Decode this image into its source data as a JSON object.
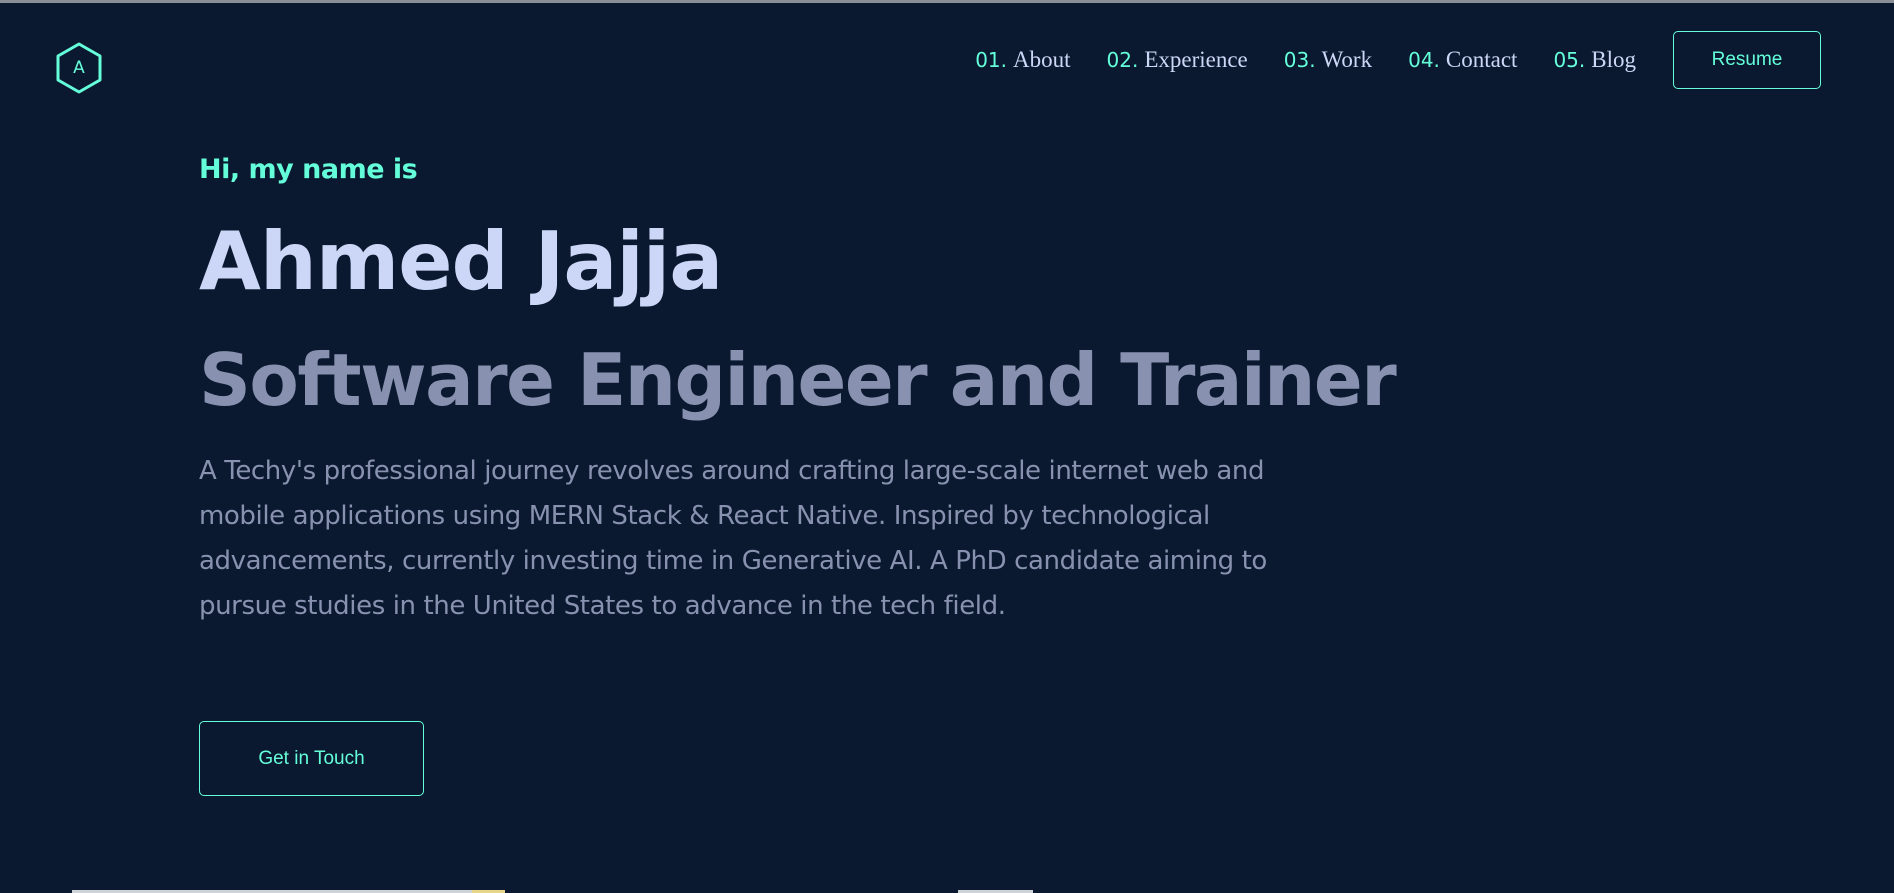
{
  "logo": {
    "letter": "A",
    "icon": "hexagon-logo-icon"
  },
  "nav": {
    "items": [
      {
        "num": "01.",
        "label": "About"
      },
      {
        "num": "02.",
        "label": "Experience"
      },
      {
        "num": "03.",
        "label": "Work"
      },
      {
        "num": "04.",
        "label": "Contact"
      },
      {
        "num": "05.",
        "label": "Blog"
      }
    ],
    "resume_label": "Resume"
  },
  "hero": {
    "greeting": "Hi, my name is",
    "name": "Ahmed Jajja",
    "title": "Software Engineer and Trainer",
    "description": "A Techy's professional journey revolves around crafting large-scale internet web and mobile applications using MERN Stack & React Native. Inspired by technological advancements, currently investing time in Generative AI. A PhD candidate aiming to pursue studies in the United States to advance in the tech field.",
    "cta_label": "Get in Touch"
  },
  "colors": {
    "background": "#0a192f",
    "accent": "#64ffda",
    "heading": "#ccd6f6",
    "muted": "#8892b0"
  }
}
